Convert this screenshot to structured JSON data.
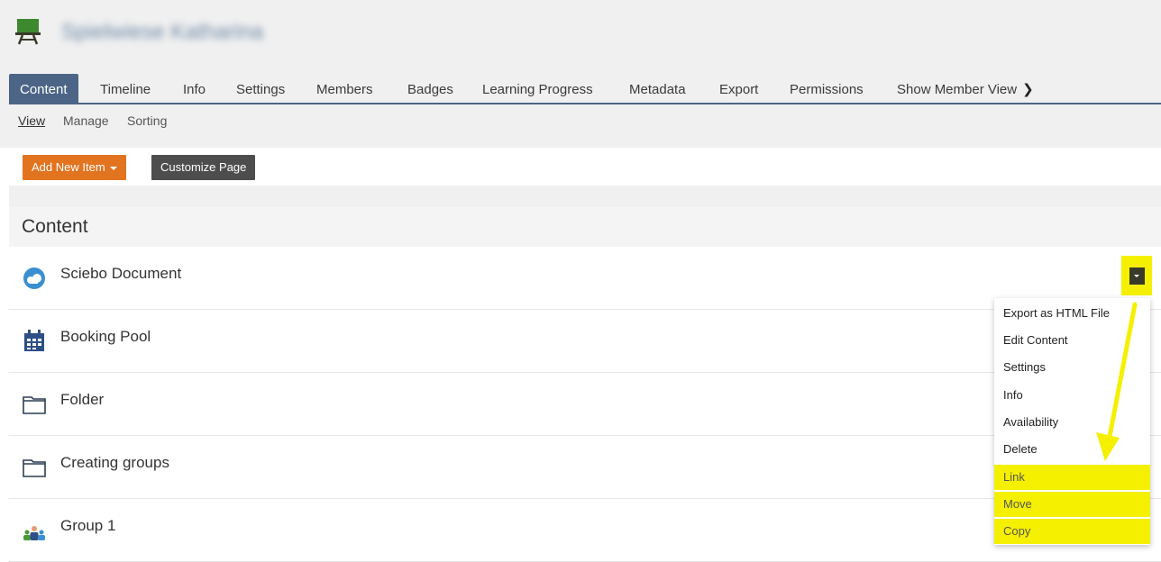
{
  "header": {
    "course_title": "Spielwiese Katharina",
    "course_icon": "easel-icon"
  },
  "tabs": [
    {
      "label": "Content",
      "active": true
    },
    {
      "label": "Timeline"
    },
    {
      "label": "Info"
    },
    {
      "label": "Settings"
    },
    {
      "label": "Members"
    },
    {
      "label": "Badges"
    },
    {
      "label": "Learning Progress"
    },
    {
      "label": "Metadata"
    },
    {
      "label": "Export"
    },
    {
      "label": "Permissions"
    },
    {
      "label": "Show Member View"
    }
  ],
  "subtabs": [
    {
      "label": "View",
      "active": true
    },
    {
      "label": "Manage"
    },
    {
      "label": "Sorting"
    }
  ],
  "toolbar": {
    "add_new_item": "Add New Item",
    "customize_page": "Customize Page"
  },
  "content": {
    "heading": "Content",
    "items": [
      {
        "title": "Sciebo Document",
        "icon": "cloud-icon"
      },
      {
        "title": "Booking Pool",
        "icon": "calendar-icon"
      },
      {
        "title": "Folder",
        "icon": "folder-icon"
      },
      {
        "title": "Creating groups",
        "icon": "folder-icon"
      },
      {
        "title": "Group 1",
        "icon": "group-icon"
      }
    ]
  },
  "actions_menu": {
    "items": [
      {
        "label": "Export as HTML File"
      },
      {
        "label": "Edit Content"
      },
      {
        "label": "Settings"
      },
      {
        "label": "Info"
      },
      {
        "label": "Availability"
      },
      {
        "label": "Delete"
      },
      {
        "label": "Link",
        "highlighted": true
      },
      {
        "label": "Move",
        "highlighted": true
      },
      {
        "label": "Copy",
        "highlighted": true
      }
    ]
  },
  "colors": {
    "tab_active": "#4c6586",
    "add_button": "#e2731f",
    "customize_button": "#4d4d4d",
    "highlight": "#f5f000"
  }
}
